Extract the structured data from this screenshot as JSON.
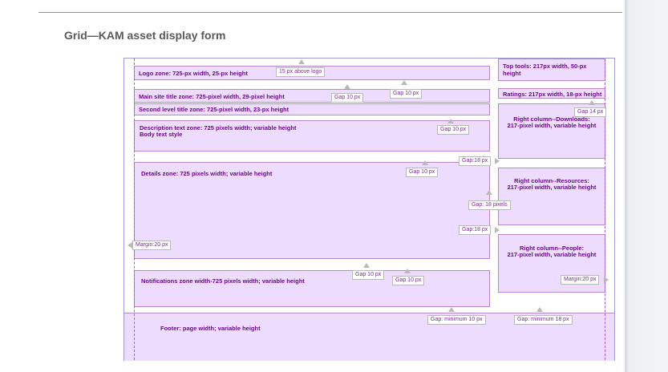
{
  "page": {
    "title": "Grid—KAM asset display form"
  },
  "zones": {
    "logo": "Logo zone: 725-px width, 25-px height",
    "top_tools": "Top tools: 217px width, 50-px height",
    "main_title": "Main site title zone: 725-pixel width, 29-pixel height",
    "ratings": "Ratings: 217px width, 18-px height",
    "second_title": "Second level title zone: 725-pixel width, 23-px height",
    "description_line1": "Description text zone: 725 pixels width; variable height",
    "description_line2": "Body text style",
    "downloads_line1": "Right column--Downloads:",
    "downloads_line2": "217-pixel width, variable height",
    "details": "Details zone: 725 pixels width; variable height",
    "resources_line1": "Right column--Resources:",
    "resources_line2": "217-pixel width, variable height",
    "people_line1": "Right column--People:",
    "people_line2": "217-pixel width, variable height",
    "notifications": "Notifications zone width-725 pixels width; variable height",
    "footer": "Footer: page width; variable height"
  },
  "callouts": {
    "above_logo": "15 px above logo",
    "gap_main_a": "Gap 10 px",
    "gap_main_b": "Gap 10 px",
    "gap_14": "Gap 14 px",
    "gap_desc": "Gap 10 px",
    "gap_18_a": "Gap:18 px",
    "gap_details": "Gap 10 px",
    "gap_18_pixels": "Gap: 18 pixels",
    "gap_18_b": "Gap:18 px",
    "margin_left": "Margin:20 px",
    "gap_notif_a": "Gap 10 px",
    "gap_notif_b": "Gap 10 px",
    "margin_right": "Margin:20 px",
    "gap_min_10": "Gap: minimum 10 px",
    "gap_min_18": "Gap: minimum 18 px"
  },
  "colors": {
    "zone_fill": "#eedcff",
    "zone_border": "#b888cf",
    "zone_text": "#6a0a8a",
    "callout_text": "#7a2a9a",
    "guide_line": "#b05acb"
  }
}
